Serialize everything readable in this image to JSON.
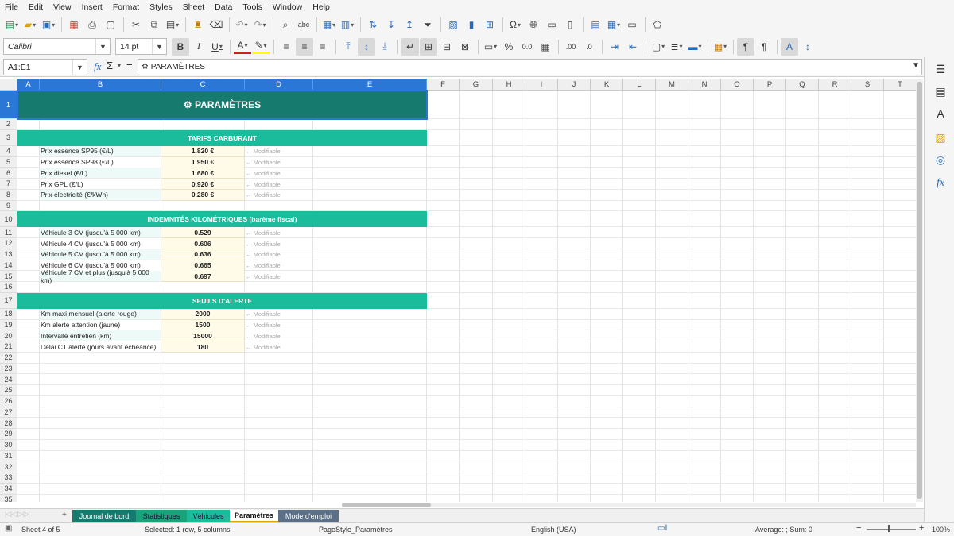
{
  "menu": [
    "File",
    "Edit",
    "View",
    "Insert",
    "Format",
    "Styles",
    "Sheet",
    "Data",
    "Tools",
    "Window",
    "Help"
  ],
  "format": {
    "font_name": "Calibri",
    "font_size": "14 pt"
  },
  "formula_bar": {
    "name_box": "A1:E1",
    "content": "⚙ PARAMÈTRES"
  },
  "columns": [
    "A",
    "B",
    "C",
    "D",
    "E",
    "F",
    "G",
    "H",
    "I",
    "J",
    "K",
    "L",
    "M",
    "N",
    "O",
    "P",
    "Q",
    "R",
    "S",
    "T"
  ],
  "rows": [
    "1",
    "2",
    "3",
    "4",
    "5",
    "6",
    "7",
    "8",
    "9",
    "10",
    "11",
    "12",
    "13",
    "14",
    "15",
    "16",
    "17",
    "18",
    "19",
    "20",
    "21",
    "22",
    "23",
    "24",
    "25",
    "26",
    "27",
    "28",
    "29",
    "30",
    "31",
    "32",
    "33",
    "34",
    "35"
  ],
  "sheet": {
    "title": "⚙ PARAMÈTRES",
    "modifiable": "← Modifiable",
    "sections": [
      {
        "header": "TARIFS CARBURANT",
        "items": [
          {
            "label": "Prix essence SP95 (€/L)",
            "value": "1.820 €"
          },
          {
            "label": "Prix essence SP98 (€/L)",
            "value": "1.950 €"
          },
          {
            "label": "Prix diesel (€/L)",
            "value": "1.680 €"
          },
          {
            "label": "Prix GPL (€/L)",
            "value": "0.920 €"
          },
          {
            "label": "Prix électricité (€/kWh)",
            "value": "0.280 €"
          }
        ]
      },
      {
        "header": "INDEMNITÉS KILOMÉTRIQUES (barème fiscal)",
        "items": [
          {
            "label": "Véhicule 3 CV (jusqu'à 5 000 km)",
            "value": "0.529"
          },
          {
            "label": "Véhicule 4 CV (jusqu'à 5 000 km)",
            "value": "0.606"
          },
          {
            "label": "Véhicule 5 CV (jusqu'à 5 000 km)",
            "value": "0.636"
          },
          {
            "label": "Véhicule 6 CV (jusqu'à 5 000 km)",
            "value": "0.665"
          },
          {
            "label": "Véhicule 7 CV et plus (jusqu'à 5 000 km)",
            "value": "0.697"
          }
        ]
      },
      {
        "header": "SEUILS D'ALERTE",
        "items": [
          {
            "label": "Km maxi mensuel (alerte rouge)",
            "value": "2000"
          },
          {
            "label": "Km alerte attention (jaune)",
            "value": "1500"
          },
          {
            "label": "Intervalle entretien (km)",
            "value": "15000"
          },
          {
            "label": "Délai CT alerte (jours avant échéance)",
            "value": "180"
          }
        ]
      }
    ]
  },
  "tabs": [
    {
      "label": "Journal de bord",
      "color": "#167a6e"
    },
    {
      "label": "Statistiques",
      "color": "#1aa37a"
    },
    {
      "label": "Véhicules",
      "color": "#1abc9c"
    },
    {
      "label": "Paramètres",
      "color": "#ffffff",
      "active": true
    },
    {
      "label": "Mode d'emploi",
      "color": "#5b6f86"
    }
  ],
  "status": {
    "sheet": "Sheet 4 of 5",
    "selection": "Selected: 1 row, 5 columns",
    "page_style": "PageStyle_Paramètres",
    "language": "English (USA)",
    "sum": "Average: ; Sum: 0",
    "zoom": "100%"
  },
  "colors": {
    "banner": "#167a6e",
    "section": "#1abc9c",
    "value_bg": "#fffbe8",
    "selection": "#2a77d6"
  }
}
